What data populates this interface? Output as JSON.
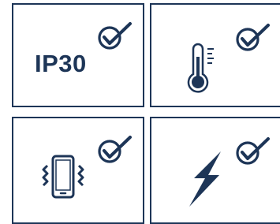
{
  "tiles": [
    {
      "id": "ip-rating",
      "text": "IP30",
      "icon": "check-icon"
    },
    {
      "id": "temperature",
      "icon": "thermometer-icon"
    },
    {
      "id": "vibration",
      "icon": "vibrating-phone-icon"
    },
    {
      "id": "power",
      "icon": "lightning-bolt-icon"
    }
  ],
  "colors": {
    "accent": "#1d3557",
    "background": "#ffffff"
  }
}
